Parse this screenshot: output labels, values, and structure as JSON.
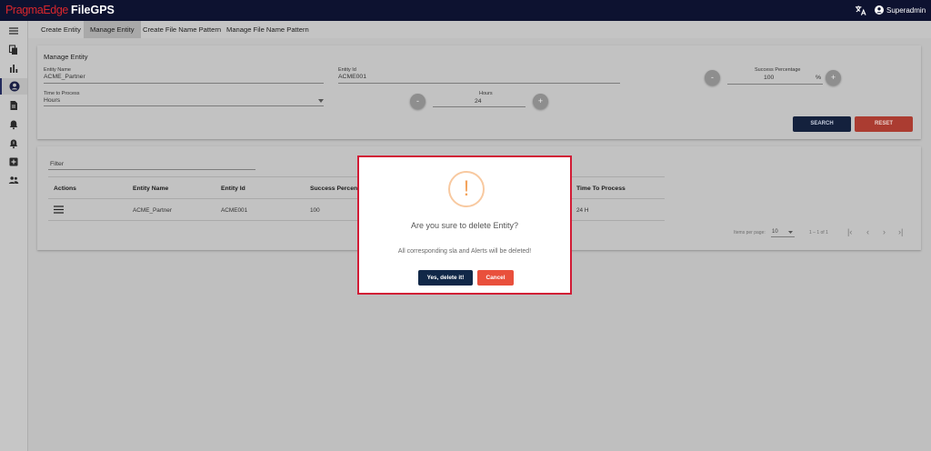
{
  "app": {
    "brand_part1": "PragmaEdge",
    "brand_part2": "FileGPS",
    "user_name": "Superadmin"
  },
  "colors": {
    "topbar": "#0d1230",
    "brand_red": "#d9262c",
    "search_button": "#14213d",
    "reset_button": "#ab3c31",
    "modal_border": "#d11b35",
    "warning": "#f3a35c",
    "confirm_button": "#112848",
    "cancel_button": "#e9503c"
  },
  "sidebar": {
    "items": [
      {
        "icon": "menu-icon"
      },
      {
        "icon": "copy-icon"
      },
      {
        "icon": "bar-chart-icon"
      },
      {
        "icon": "account-circle-icon",
        "active": true
      },
      {
        "icon": "document-icon"
      },
      {
        "icon": "bell-icon"
      },
      {
        "icon": "alert-bell-icon"
      },
      {
        "icon": "plus-box-icon"
      },
      {
        "icon": "people-icon"
      }
    ]
  },
  "tabs": [
    "Create Entity",
    "Manage Entity",
    "Create File Name Pattern",
    "Manage File Name Pattern"
  ],
  "form": {
    "title": "Manage Entity",
    "entity_name_label": "Entity Name",
    "entity_name_value": "ACME_Partner",
    "entity_id_label": "Entity Id",
    "entity_id_value": "ACME001",
    "success_label": "Success Percentage",
    "success_value": "100",
    "percent_sign": "%",
    "time_label": "Time to Process",
    "time_value": "Hours",
    "hours_label": "Hours",
    "hours_value": "24",
    "minus": "-",
    "plus": "+",
    "search_label": "SEARCH",
    "reset_label": "RESET"
  },
  "table": {
    "filter_placeholder": "Filter",
    "headers": [
      "Actions",
      "Entity Name",
      "Entity Id",
      "Success Percenta",
      "Time To Process"
    ],
    "row": {
      "entity_name": "ACME_Partner",
      "entity_id": "ACME001",
      "success": "100",
      "time": "24 H"
    },
    "paginator": {
      "items_per_page_label": "Items per page:",
      "page_size": "10",
      "range": "1 – 1 of 1"
    }
  },
  "dialog": {
    "icon": "!",
    "title": "Are you sure to delete Entity?",
    "text": "All corresponding sla and Alerts will be deleted!",
    "confirm_label": "Yes, delete it!",
    "cancel_label": "Cancel"
  }
}
